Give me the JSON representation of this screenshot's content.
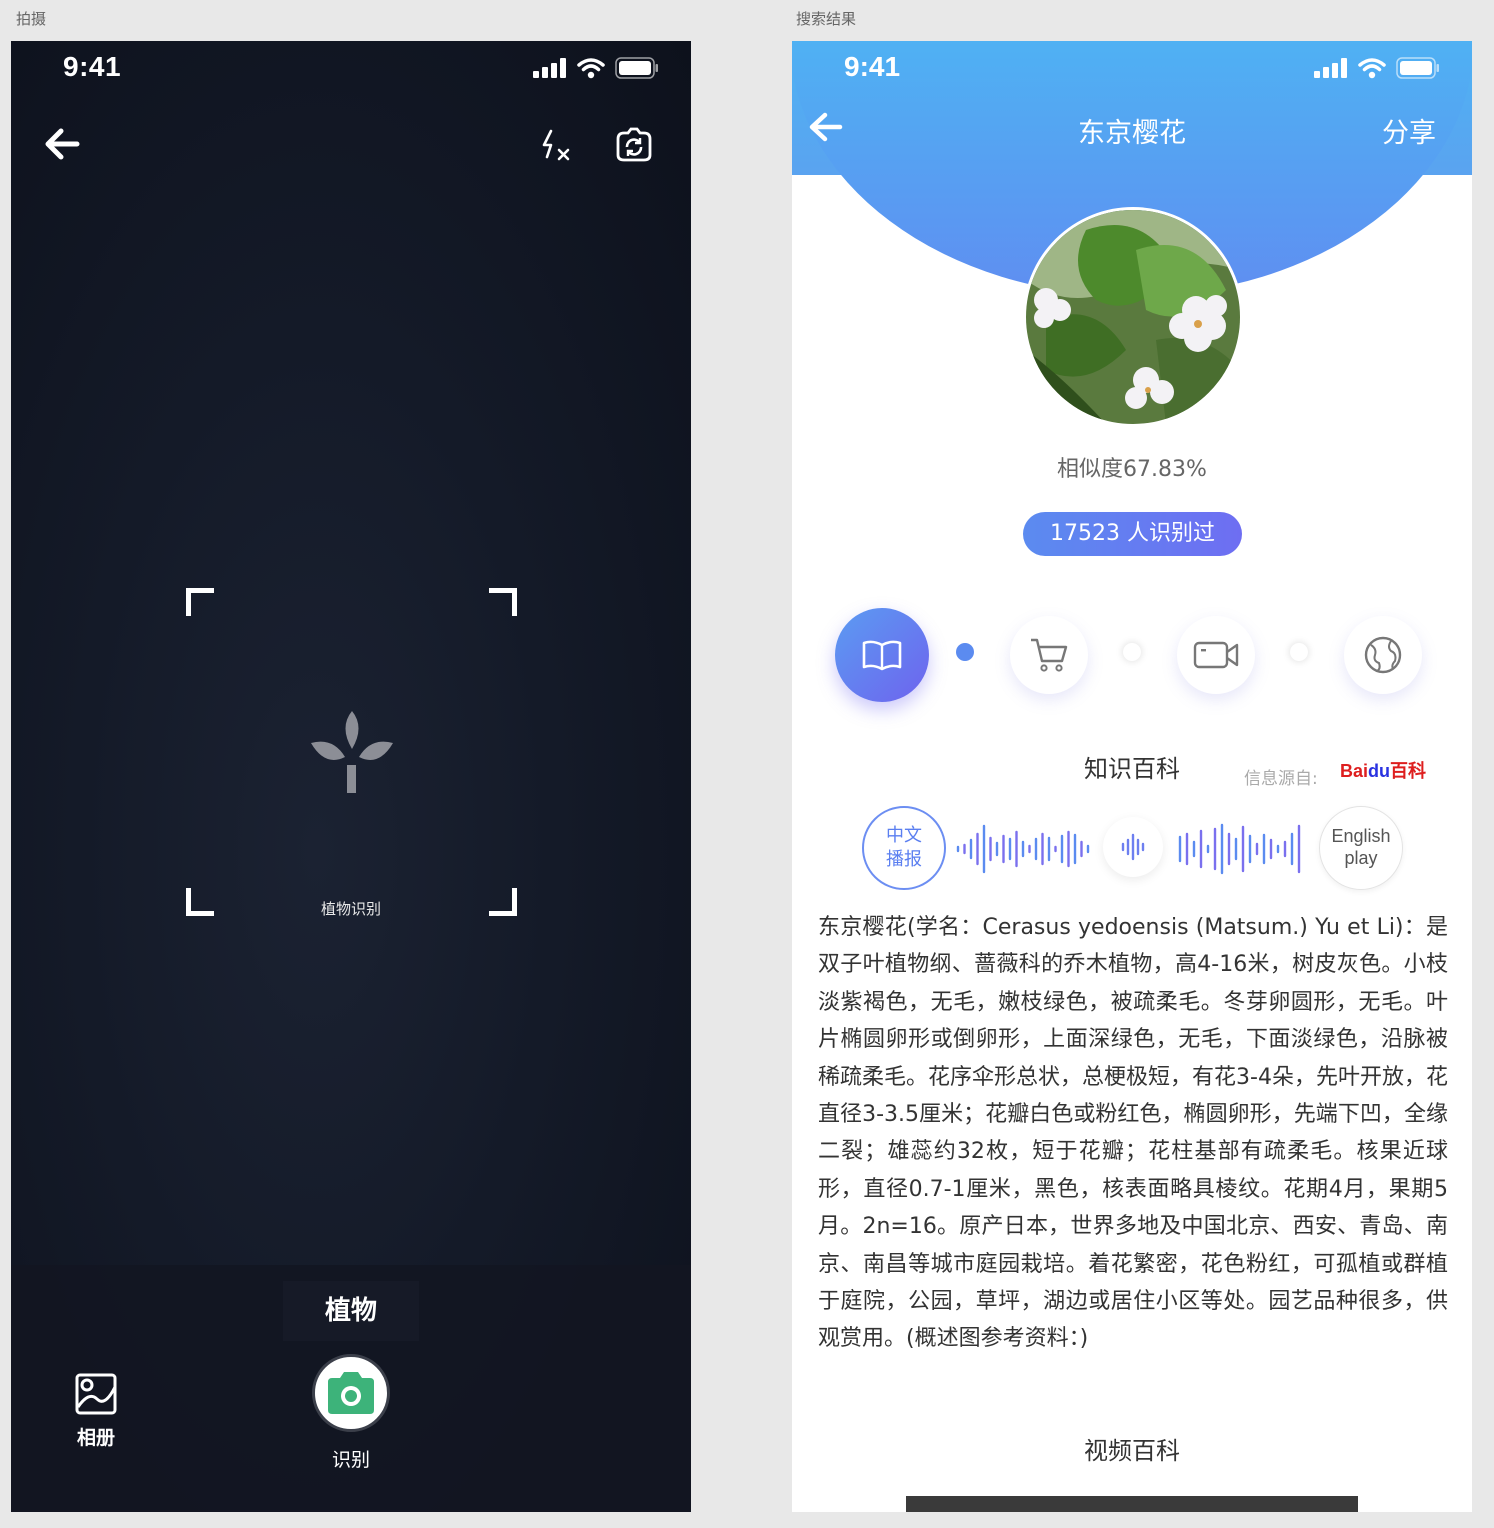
{
  "artboards": {
    "camera_label": "拍摄",
    "result_label": "搜索结果"
  },
  "camera": {
    "status_time": "9:41",
    "scan_hint": "植物识别",
    "mode_label": "植物",
    "album_label": "相册",
    "shutter_label": "识别"
  },
  "result": {
    "status_time": "9:41",
    "title": "东京樱花",
    "share_label": "分享",
    "similarity": "相似度67.83%",
    "count_text": "17523 人识别过",
    "tabs": [
      "book-icon",
      "cart-icon",
      "video-icon",
      "globe-icon"
    ],
    "knowledge_title": "知识百科",
    "source_label": "信息源自:",
    "source_brand": "Baidu百科",
    "play_cn_line1": "中文",
    "play_cn_line2": "播报",
    "play_en_line1": "English",
    "play_en_line2": "play",
    "description": "东京樱花(学名：Cerasus yedoensis (Matsum.) Yu et Li)：是双子叶植物纲、蔷薇科的乔木植物，高4-16米，树皮灰色。小枝淡紫褐色，无毛，嫩枝绿色，被疏柔毛。冬芽卵圆形，无毛。叶片椭圆卵形或倒卵形，上面深绿色，无毛，下面淡绿色，沿脉被稀疏柔毛。花序伞形总状，总梗极短，有花3-4朵，先叶开放，花直径3-3.5厘米；花瓣白色或粉红色，椭圆卵形，先端下凹，全缘二裂；雄蕊约32枚，短于花瓣；花柱基部有疏柔毛。核果近球形，直径0.7-1厘米，黑色，核表面略具棱纹。花期4月，果期5月。2n=16。原产日本，世界多地及中国北京、西安、青岛、南京、南昌等城市庭园栽培。着花繁密，花色粉红，可孤植或群植于庭院，公园，草坪，湖边或居住小区等处。园艺品种很多，供观赏用。(概述图参考资料：)",
    "video_title": "视频百科"
  },
  "colors": {
    "accent": "#5b7ff0",
    "header_top": "#4fb1f3",
    "header_bottom": "#5f8ef1",
    "shutter": "#3db37a"
  }
}
